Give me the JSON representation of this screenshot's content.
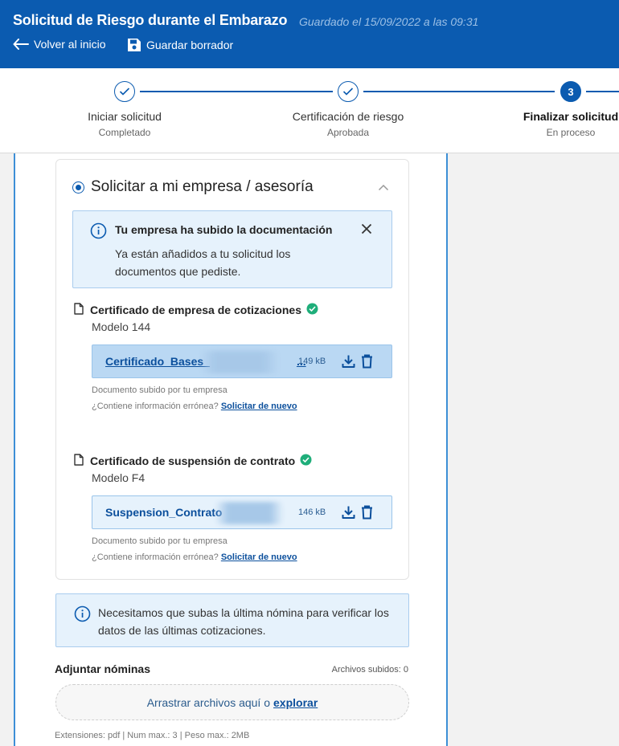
{
  "header": {
    "title": "Solicitud de Riesgo durante el Embarazo",
    "saved_text": "Guardado el 15/09/2022 a las 09:31",
    "back_label": "Volver al inicio",
    "draft_label": "Guardar borrador",
    "bg_color": "#0b5bb0"
  },
  "stepper": {
    "steps": [
      {
        "label": "Iniciar solicitud",
        "status": "Completado",
        "state": "done"
      },
      {
        "label": "Certificación de riesgo",
        "status": "Aprobada",
        "state": "done"
      },
      {
        "label": "Finalizar solicitud",
        "status": "En proceso",
        "state": "active",
        "number": "3"
      }
    ]
  },
  "card": {
    "title": "Solicitar a mi empresa / asesoría",
    "info": {
      "title": "Tu empresa ha subido la documentación",
      "text": "Ya están añadidos a tu solicitud los documentos que pediste."
    },
    "documents": [
      {
        "name": "Certificado de empresa de cotizaciones",
        "model": "Modelo 144",
        "file_name": "Certificado_Bases_",
        "file_suffix": "...",
        "size": "149 kB",
        "uploaded_text": "Documento subido por tu empresa",
        "error_text": "¿Contiene información errónea?",
        "error_link": "Solicitar de nuevo"
      },
      {
        "name": "Certificado de suspensión de contrato",
        "model": "Modelo F4",
        "file_name": "Suspension_Contrato",
        "file_suffix": "",
        "size": "146 kB",
        "uploaded_text": "Documento subido por tu empresa",
        "error_text": "¿Contiene información errónea?",
        "error_link": "Solicitar de nuevo"
      }
    ]
  },
  "notice": {
    "text": "Necesitamos que subas la última nómina para verificar los datos de las últimas cotizaciones."
  },
  "upload": {
    "title": "Adjuntar nóminas",
    "count": "Archivos subidos: 0",
    "drop_text": "Arrastrar archivos aquí o",
    "drop_link": "explorar",
    "extensions": "Extensiones: pdf | Num max.: 3 | Peso max.: 2MB"
  },
  "colors": {
    "primary": "#0b5bb0",
    "success": "#1fae7a",
    "info_bg": "#e6f2fc"
  }
}
